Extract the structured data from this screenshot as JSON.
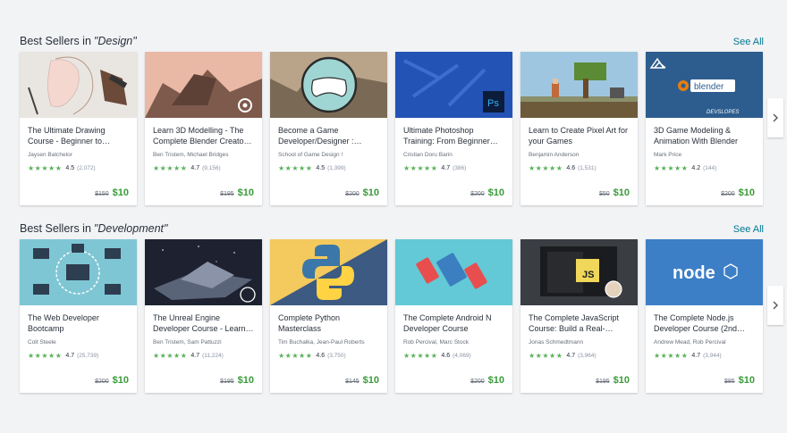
{
  "sections": [
    {
      "label": "Best Sellers in",
      "category": "\"Design\"",
      "see_all": "See All",
      "courses": [
        {
          "title": "The Ultimate Drawing Course - Beginner to…",
          "author": "Jaysen Batchelor",
          "rating": "4.5",
          "count": "(2,072)",
          "orig_price": "$150",
          "price": "$10"
        },
        {
          "title": "Learn 3D Modelling - The Complete Blender Creato…",
          "author": "Ben Tristem, Michael Bridges",
          "rating": "4.7",
          "count": "(9,156)",
          "orig_price": "$195",
          "price": "$10"
        },
        {
          "title": "Become a Game Developer/Designer :…",
          "author": "School of Game Design !",
          "rating": "4.5",
          "count": "(1,399)",
          "orig_price": "$200",
          "price": "$10"
        },
        {
          "title": "Ultimate Photoshop Training: From Beginner…",
          "author": "Cristian Doru Barin",
          "rating": "4.7",
          "count": "(386)",
          "orig_price": "$200",
          "price": "$10"
        },
        {
          "title": "Learn to Create Pixel Art for your Games",
          "author": "Benjamin Anderson",
          "rating": "4.6",
          "count": "(1,531)",
          "orig_price": "$50",
          "price": "$10"
        },
        {
          "title": "3D Game Modeling & Animation With Blender",
          "author": "Mark Price",
          "rating": "4.2",
          "count": "(144)",
          "orig_price": "$200",
          "price": "$10"
        }
      ]
    },
    {
      "label": "Best Sellers in",
      "category": "\"Development\"",
      "see_all": "See All",
      "courses": [
        {
          "title": "The Web Developer Bootcamp",
          "author": "Colt Steele",
          "rating": "4.7",
          "count": "(25,739)",
          "orig_price": "$200",
          "price": "$10"
        },
        {
          "title": "The Unreal Engine Developer Course - Learn…",
          "author": "Ben Tristem, Sam Pattuzzi",
          "rating": "4.7",
          "count": "(11,224)",
          "orig_price": "$195",
          "price": "$10"
        },
        {
          "title": "Complete Python Masterclass",
          "author": "Tim Buchalka, Jean-Paul Roberts",
          "rating": "4.6",
          "count": "(3,750)",
          "orig_price": "$145",
          "price": "$10"
        },
        {
          "title": "The Complete Android N Developer Course",
          "author": "Rob Percival, Marc Stock",
          "rating": "4.6",
          "count": "(4,069)",
          "orig_price": "$200",
          "price": "$10"
        },
        {
          "title": "The Complete JavaScript Course: Build a Real-…",
          "author": "Jonas Schmedtmann",
          "rating": "4.7",
          "count": "(3,964)",
          "orig_price": "$195",
          "price": "$10"
        },
        {
          "title": "The Complete Node.js Developer Course (2nd…",
          "author": "Andrew Mead, Rob Percival",
          "rating": "4.7",
          "count": "(3,944)",
          "orig_price": "$85",
          "price": "$10"
        }
      ]
    }
  ],
  "thumb_text": {
    "ps": "Ps",
    "blender": "blender",
    "devslopes": "DEVSLOPES",
    "js": "JS",
    "node": "node"
  },
  "stars": "★★★★★",
  "colors": {
    "accent": "#007791",
    "price": "#3a9b3a",
    "stars": "#5bb15b"
  }
}
